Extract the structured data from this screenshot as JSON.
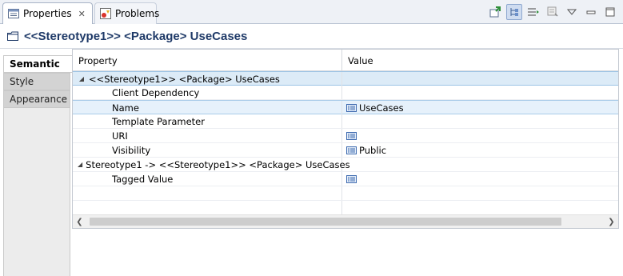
{
  "tabs": [
    {
      "label": "Properties",
      "icon": "properties-view-icon",
      "closable": true,
      "active": true
    },
    {
      "label": "Problems",
      "icon": "problems-view-icon",
      "closable": false,
      "active": false
    }
  ],
  "toolbar": {
    "items": [
      "pin-icon",
      "show-categories-icon",
      "show-advanced-icon",
      "restore-default-icon",
      "view-menu-icon",
      "minimize-icon",
      "maximize-icon"
    ]
  },
  "header": {
    "icon": "folder-icon",
    "title": "<<Stereotype1>> <Package> UseCases"
  },
  "sideTabs": {
    "semantic": "Semantic",
    "style": "Style",
    "appearance": "Appearance"
  },
  "table": {
    "columns": {
      "property": "Property",
      "value": "Value"
    },
    "rows": [
      {
        "property": "<<Stereotype1>> <Package> UseCases",
        "value": "",
        "level": 0,
        "expanded": true,
        "valueIcon": false
      },
      {
        "property": "Client Dependency",
        "value": "",
        "level": 1,
        "valueIcon": false
      },
      {
        "property": "Name",
        "value": "UseCases",
        "level": 1,
        "valueIcon": true
      },
      {
        "property": "Template Parameter",
        "value": "",
        "level": 1,
        "valueIcon": false
      },
      {
        "property": "URI",
        "value": "",
        "level": 1,
        "valueIcon": true
      },
      {
        "property": "Visibility",
        "value": "Public",
        "level": 1,
        "valueIcon": true
      },
      {
        "property": "Stereotype1 -> <<Stereotype1>> <Package> UseCases",
        "value": "",
        "level": 0,
        "expanded": true,
        "valueIcon": false
      },
      {
        "property": "Tagged Value",
        "value": "",
        "level": 1,
        "valueIcon": true
      }
    ]
  },
  "colors": {
    "titleText": "#1f3a68",
    "selectedRow": "#dcebf7"
  }
}
